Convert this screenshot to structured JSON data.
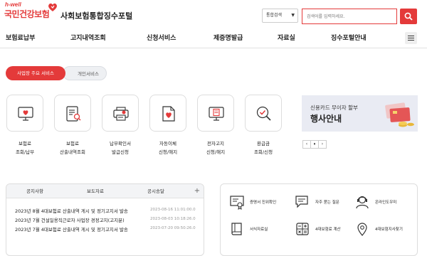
{
  "brand": {
    "logo_top": "h-well",
    "logo_main": "국민건강보험",
    "site_title": "사회보험통합징수포털",
    "accent_color": "#e43a3a"
  },
  "search": {
    "select_value": "통합검색",
    "placeholder": "검색어를 입력하세요.",
    "button_icon": "search-icon"
  },
  "nav": {
    "items": [
      "보험료납부",
      "고지내역조회",
      "신청서비스",
      "제증명발급",
      "자료실",
      "징수포털안내"
    ],
    "menu_icon": "hamburger-icon"
  },
  "service_tabs": [
    "사업장 주요 서비스",
    "개인서비스"
  ],
  "services": [
    {
      "line1": "보험료",
      "line2": "조회/납부",
      "icon": "monitor-heart-icon"
    },
    {
      "line1": "보험료",
      "line2": "산출내역조회",
      "icon": "document-search-icon"
    },
    {
      "line1": "납부확인서",
      "line2": "발급신청",
      "icon": "printer-icon"
    },
    {
      "line1": "자동이체",
      "line2": "신청/해지",
      "icon": "document-heart-icon"
    },
    {
      "line1": "전자고지",
      "line2": "신청/해지",
      "icon": "monitor-document-icon"
    },
    {
      "line1": "환급금",
      "line2": "조회/신청",
      "icon": "refund-search-icon"
    }
  ],
  "banner": {
    "subtitle": "신용카드 무이자 할부",
    "title": "행사안내",
    "controls": [
      "‹",
      "⏸",
      "›"
    ]
  },
  "board": {
    "tabs": [
      "공지사항",
      "보도자료",
      "공시송달"
    ],
    "more": "+",
    "rows": [
      {
        "title": "2023년 8월 4대보험료 산출내역 게시 및 정기고지서 발송",
        "date": "2023-08-16 11:01:00.0"
      },
      {
        "title": "2023년 7월 건설일용직근로자 사업장 경정고지(고지분)",
        "date": "2023-08-03 10:18:26.0"
      },
      {
        "title": "2023년 7월 4대보험료 산출내역 게시 및 정기고지서 발송",
        "date": "2023-07-20 09:50:26.0"
      }
    ]
  },
  "quick_links": [
    {
      "label": "증명서 진위확인",
      "icon": "certificate-icon"
    },
    {
      "label": "자주 묻는 질문",
      "icon": "chat-icon"
    },
    {
      "label": "온라인도우미",
      "icon": "support-agent-icon"
    },
    {
      "label": "서식자료실",
      "icon": "book-icon"
    },
    {
      "label": "4대보험료 계산",
      "icon": "calculator-icon"
    },
    {
      "label": "4대보험지사찾기",
      "icon": "location-pin-icon"
    }
  ]
}
